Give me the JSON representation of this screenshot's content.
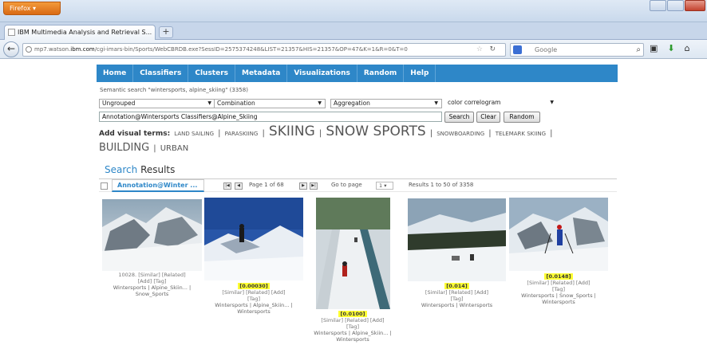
{
  "browser": {
    "app_button": "Firefox",
    "tab_title": "IBM Multimedia Analysis and Retrieval S...",
    "new_tab": "+",
    "url_prefix": "mp7.watson.",
    "url_domain": "ibm.com",
    "url_path": "/cgi-imars-bin/Sports/WebCBRDB.exe?SessID=2575374248&LIST=21357&HIS=21357&OP=47&K=1&R=0&T=0",
    "search_placeholder": "Google",
    "icons": [
      "back-icon",
      "site-identity-icon",
      "bookmark-star-icon",
      "reload-icon",
      "search-engine-icon",
      "magnifier-icon",
      "bookmarks-icon",
      "download-icon",
      "home-icon"
    ]
  },
  "menu": [
    "Home",
    "Classifiers",
    "Clusters",
    "Metadata",
    "Visualizations",
    "Random",
    "Help"
  ],
  "semantic_search": "Semantic search \"wintersports, alpine_skiing\" (3358)",
  "selects": {
    "grouping": "Ungrouped",
    "combination": "Combination",
    "aggregation": "Aggregation",
    "feature": "color correlogram"
  },
  "query": "Annotation@Wintersports Classifiers@Alpine_Skiing",
  "buttons": {
    "search": "Search",
    "clear": "Clear",
    "random": "Random"
  },
  "visual_terms": {
    "lead": "Add visual terms:",
    "terms": [
      "LAND SAILING",
      "PARASKIING",
      "SKIING",
      "SNOW SPORTS",
      "SNOWBOARDING",
      "TELEMARK SKIING",
      "BUILDING",
      "URBAN"
    ],
    "separator": "|"
  },
  "results_heading": {
    "word1": "Search",
    "word2": "Results"
  },
  "pager": {
    "tab_label": "Annotation@Winter ...",
    "first": "|◀",
    "prev": "◀",
    "next": "▶",
    "last": "▶|",
    "page_text": "Page 1 of 68",
    "go_label": "Go to page",
    "go_value": "1",
    "range_text": "Results 1 to 50 of 3358"
  },
  "results": [
    {
      "id_label": "10028.",
      "score": "",
      "actions": "[Similar] [Related]",
      "actions2": "[Add] [Tag]",
      "tags": "Wintersports | Alpine_Skiin... |",
      "tags2": "Snow_Sports"
    },
    {
      "id_label": "",
      "score": "[0.00030]",
      "actions": "[Similar] [Related] [Add]",
      "actions2": "[Tag]",
      "tags": "Wintersports | Alpine_Skiin... |",
      "tags2": "Wintersports"
    },
    {
      "id_label": "",
      "score": "[0.0100]",
      "actions": "[Similar] [Related] [Add]",
      "actions2": "[Tag]",
      "tags": "Wintersports | Alpine_Skiin... |",
      "tags2": "Wintersports"
    },
    {
      "id_label": "",
      "score": "[0.014]",
      "actions": "[Similar] [Related] [Add]",
      "actions2": "[Tag]",
      "tags": "Wintersports | Wintersports",
      "tags2": ""
    },
    {
      "id_label": "",
      "score": "[0.0148]",
      "actions": "[Similar] [Related] [Add]",
      "actions2": "[Tag]",
      "tags": "Wintersports | Snow_Sports |",
      "tags2": "Wintersports"
    }
  ]
}
